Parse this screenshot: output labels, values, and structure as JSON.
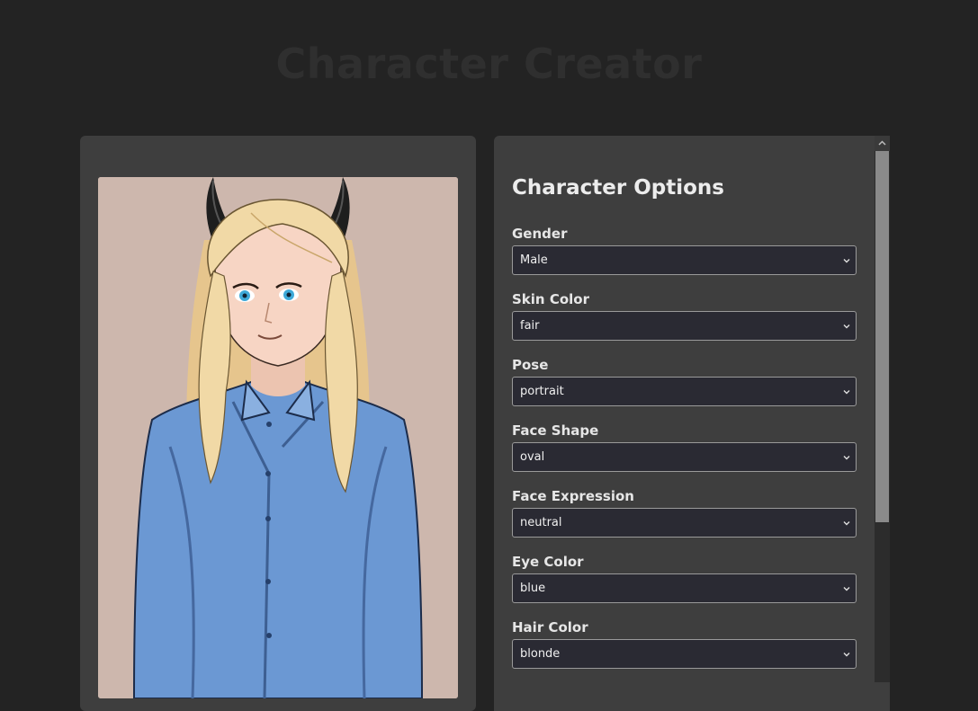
{
  "page": {
    "title": "Character Creator"
  },
  "options": {
    "heading": "Character Options",
    "fields": [
      {
        "label": "Gender",
        "value": "Male"
      },
      {
        "label": "Skin Color",
        "value": "fair"
      },
      {
        "label": "Pose",
        "value": "portrait"
      },
      {
        "label": "Face Shape",
        "value": "oval"
      },
      {
        "label": "Face Expression",
        "value": "neutral"
      },
      {
        "label": "Eye Color",
        "value": "blue"
      },
      {
        "label": "Hair Color",
        "value": "blonde"
      }
    ]
  },
  "preview": {
    "background_color": "#cdb7ad",
    "hair_color": "#f1d9a6",
    "eye_color": "#3fa9d8",
    "shirt_color": "#6b98d3",
    "skin_color": "#f7d5c4",
    "horn_color": "#1e1e1e"
  },
  "colors": {
    "page_background": "#232323",
    "panel_background": "#3e3e3e",
    "select_background": "#2a2a33",
    "text": "#e6e6e6"
  }
}
